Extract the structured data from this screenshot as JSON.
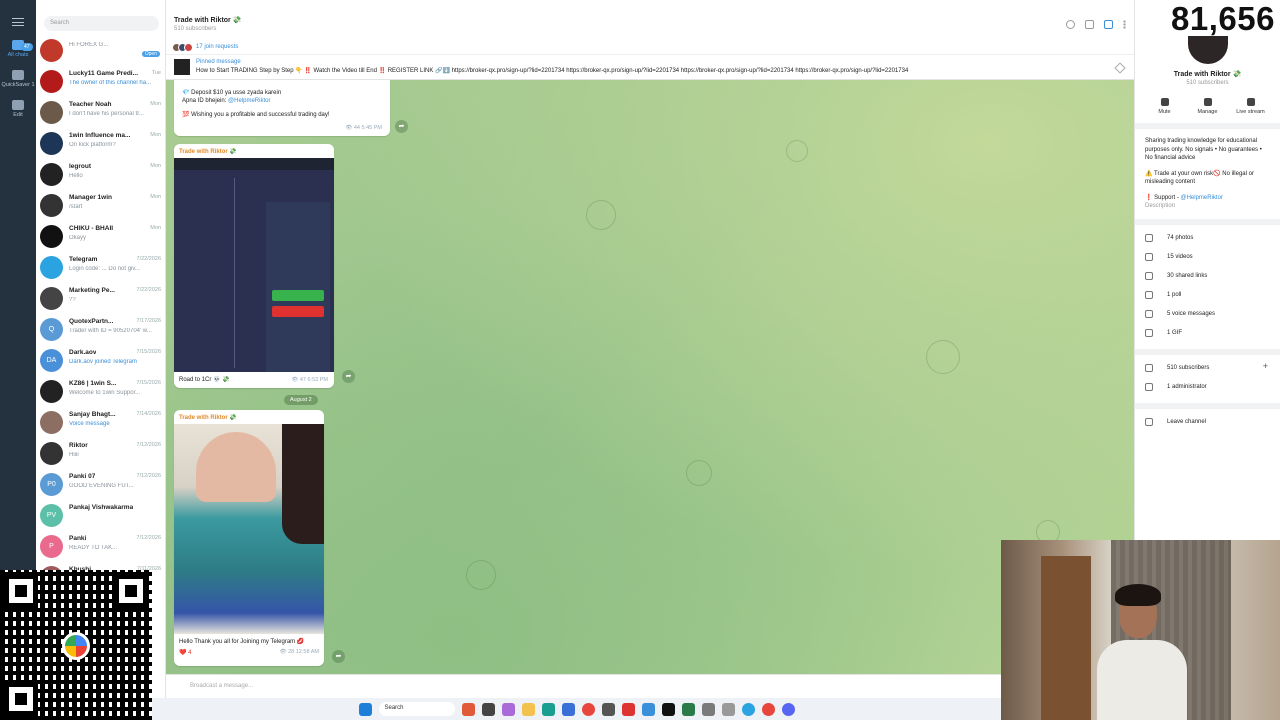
{
  "rail": {
    "all_chats": "All chats",
    "badge": "47",
    "quicksaver": "QuickSaver 1",
    "edit": "Edit"
  },
  "search": {
    "placeholder": "Search"
  },
  "chats": [
    {
      "name": "",
      "time": "",
      "preview": "Hi FOREX G...",
      "badge": "Open",
      "initials": "",
      "color": "#c0392b"
    },
    {
      "name": "Lucky11 Game Predi...",
      "time": "Tue",
      "preview": "The owner of this channel ha...",
      "blue": true,
      "initials": "",
      "color": "#b31b1b"
    },
    {
      "name": "Teacher Noah",
      "time": "Mon",
      "preview": "I don't have his personal tr...",
      "initials": "",
      "color": "#6b5a4a"
    },
    {
      "name": "1win Influence ma...",
      "time": "Mon",
      "preview": "On kick platform?",
      "initials": "",
      "color": "#1d3557"
    },
    {
      "name": "legrout",
      "time": "Mon",
      "preview": "Hello",
      "initials": "",
      "color": "#222"
    },
    {
      "name": "Manager 1win",
      "time": "Mon",
      "preview": "/start",
      "initials": "",
      "color": "#333"
    },
    {
      "name": "CHIKU - BHAII",
      "time": "Mon",
      "preview": "Okayy",
      "initials": "",
      "color": "#111"
    },
    {
      "name": "Telegram",
      "time": "7/22/2026",
      "preview": "Login code: ... Do not giv...",
      "initials": "",
      "color": "#2aa3e0"
    },
    {
      "name": "Marketing Pe...",
      "time": "7/22/2026",
      "preview": "??",
      "initials": "",
      "color": "#444"
    },
    {
      "name": "QuotexPartn...",
      "time": "7/17/2026",
      "preview": "Trader with ID = 90520704' w...",
      "initials": "Q",
      "color": "#5b9bd5"
    },
    {
      "name": "Dark.aov",
      "time": "7/15/2026",
      "preview": "Dark.aov joined Telegram",
      "blue": true,
      "initials": "DA",
      "color": "#4a90d9"
    },
    {
      "name": "KZ86 | 1win S...",
      "time": "7/15/2026",
      "preview": "Welcome to 1win Suppor...",
      "initials": "",
      "color": "#222"
    },
    {
      "name": "Sanjay Bhagt...",
      "time": "7/14/2026",
      "preview": "Voice message",
      "blue": true,
      "initials": "",
      "color": "#8d6e63"
    },
    {
      "name": "Riktor",
      "time": "7/12/2026",
      "preview": "Hiiii",
      "initials": "",
      "color": "#333"
    },
    {
      "name": "Panki 07",
      "time": "7/12/2026",
      "preview": "GOOD EVENING FUT...",
      "initials": "P0",
      "color": "#5b9bd5"
    },
    {
      "name": "Pankaj Vishwakarma",
      "time": "",
      "preview": "",
      "initials": "PV",
      "color": "#5bc0a7"
    },
    {
      "name": "Panki",
      "time": "7/12/2026",
      "preview": "READY TO TAK...",
      "initials": "P",
      "color": "#e96a8d"
    },
    {
      "name": "Khushi",
      "time": "7/11/2026",
      "preview": "",
      "initials": "",
      "color": "#a05a5a"
    }
  ],
  "header": {
    "title": "Trade with Riktor 💸",
    "subscribers": "510 subscribers",
    "join_requests": "17 join requests"
  },
  "pinned": {
    "label": "Pinned message",
    "text": "How to Start TRADING Step by Step 👇 ‼️ Watch the Video till End ‼️ REGISTER LINK 🔗⬇️ https://broker-qx.pro/sign-up/?lid=2201734 https://broker-qx.pro/sign-up/?lid=2201734 https://broker-qx.pro/sign-up/?lid=2201734 https://broker-qx.pro/sign-up/?lid=2201734"
  },
  "messages": {
    "m1_line1": "💎 Deposit $10 ya usse zyada karein",
    "m1_line2": "Apna ID bhejein: ",
    "m1_handle": "@HelpmeRiktor",
    "m1_line3": "💯 Wishing you a profitable and successful trading day!",
    "m1_views": "44",
    "m1_time": "5:45 PM",
    "m2_channel": "Trade with Riktor 💸",
    "m2_caption": "Road to 1Cr 💀 💸",
    "m2_views": "47",
    "m2_time": "6:53 PM",
    "date_pill": "August 2",
    "m3_channel": "Trade with Riktor 💸",
    "m3_caption": "Hello Thank you all for Joining my Telegram 💋",
    "m3_reactions": "❤️ 4",
    "m3_views": "28",
    "m3_time": "12:58 AM",
    "composer": "Broadcast a message..."
  },
  "right": {
    "name": "Trade with Riktor 💸",
    "subscribers": "510 subscribers",
    "buttons": [
      "Mute",
      "Manage",
      "Live stream"
    ],
    "about_1": "Sharing trading knowledge for educational purposes only. No signals • No guarantees • No financial advice",
    "about_2": "⚠️ Trade at your own risk🚫 No illegal or misleading content",
    "support_label": "❗ Support - ",
    "support_handle": "@HelpmeRiktor",
    "description_label": "Description",
    "stats": [
      "74 photos",
      "15 videos",
      "30 shared links",
      "1 poll",
      "5 voice messages",
      "1 GIF"
    ],
    "members": [
      "510 subscribers",
      "1 administrator"
    ],
    "leave": "Leave channel"
  },
  "overlay": {
    "counter": "81,656"
  },
  "taskbar": {
    "search": "Search"
  }
}
